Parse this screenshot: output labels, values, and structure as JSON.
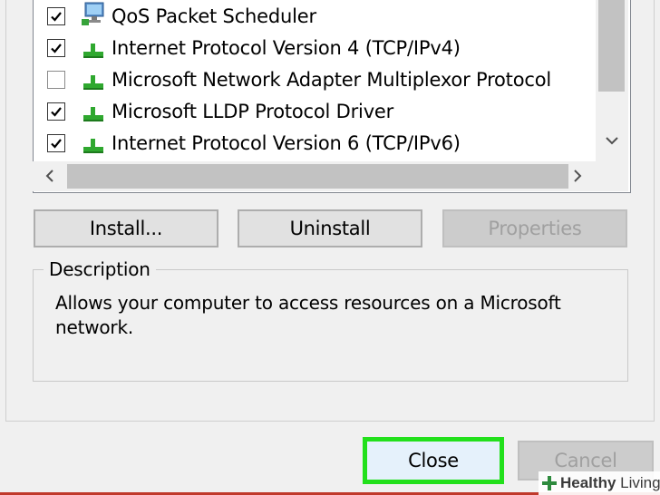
{
  "protocol_list": {
    "items": [
      {
        "label": "QoS Packet Scheduler",
        "checked": true,
        "icon": "network-service-icon"
      },
      {
        "label": "Internet Protocol Version 4 (TCP/IPv4)",
        "checked": true,
        "icon": "protocol-icon"
      },
      {
        "label": "Microsoft Network Adapter Multiplexor Protocol",
        "checked": false,
        "icon": "protocol-icon"
      },
      {
        "label": "Microsoft LLDP Protocol Driver",
        "checked": true,
        "icon": "protocol-icon"
      },
      {
        "label": "Internet Protocol Version 6 (TCP/IPv6)",
        "checked": true,
        "icon": "protocol-icon"
      }
    ]
  },
  "buttons": {
    "install": "Install...",
    "uninstall": "Uninstall",
    "properties": "Properties"
  },
  "description": {
    "title": "Description",
    "text": "Allows your computer to access resources on a Microsoft network."
  },
  "footer": {
    "close": "Close",
    "cancel": "Cancel"
  },
  "watermark": {
    "brand_bold": "Healthy",
    "brand_rest": " Living"
  },
  "colors": {
    "highlight": "#22e01b",
    "protocol_icon": "#2fa82f",
    "accent_line": "#c0392b"
  }
}
